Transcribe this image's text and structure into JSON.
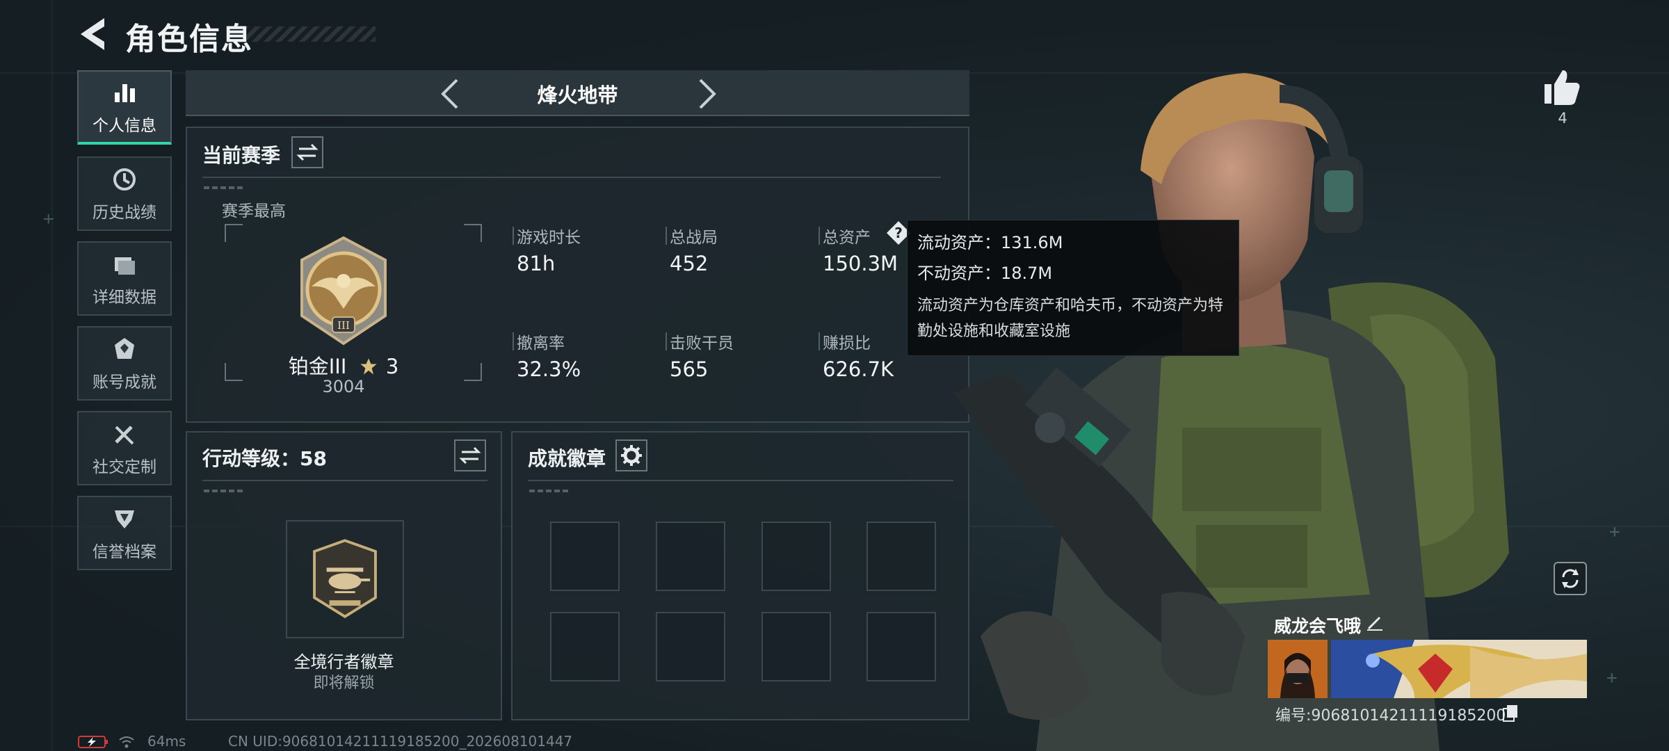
{
  "header": {
    "title": "角色信息"
  },
  "sidebar": {
    "items": [
      {
        "label": "个人信息",
        "icon": "bar-chart-icon",
        "active": true
      },
      {
        "label": "历史战绩",
        "icon": "clock-history-icon",
        "active": false
      },
      {
        "label": "详细数据",
        "icon": "folder-icon",
        "active": false
      },
      {
        "label": "账号成就",
        "icon": "achievement-icon",
        "active": false
      },
      {
        "label": "社交定制",
        "icon": "tools-icon",
        "active": false
      },
      {
        "label": "信誉档案",
        "icon": "shield-rank-icon",
        "active": false
      }
    ]
  },
  "mode_nav": {
    "title": "烽火地带"
  },
  "season": {
    "title": "当前赛季",
    "best_label": "赛季最高",
    "rank_name": "铂金III",
    "rank_stars": "3",
    "rank_score": "3004",
    "stats": [
      {
        "label": "游戏时长",
        "value": "81h"
      },
      {
        "label": "总战局",
        "value": "452"
      },
      {
        "label": "总资产",
        "value": "150.3M"
      },
      {
        "label": "撤离率",
        "value": "32.3%"
      },
      {
        "label": "击败干员",
        "value": "565"
      },
      {
        "label": "赚损比",
        "value": "626.7K"
      }
    ]
  },
  "tooltip": {
    "liquid": "流动资产：131.6M",
    "fixed": "不动资产：18.7M",
    "desc": "流动资产为仓库资产和哈夫币，不动资产为特勤处设施和收藏室设施"
  },
  "action_level": {
    "title": "行动等级：58",
    "badge_name": "全境行者徽章",
    "badge_status": "即将解锁"
  },
  "achievements": {
    "title": "成就徽章"
  },
  "profile": {
    "like_count": "4",
    "name": "威龙会飞哦",
    "id_text": "编号:906810142111191852​00"
  },
  "status_bar": {
    "ping": "64ms",
    "uid": "CN UID:906810142111191852​00_202608101447"
  },
  "colors": {
    "accent": "#2fd7a6",
    "panel": "#1e282d",
    "text": "#e6eaec"
  }
}
